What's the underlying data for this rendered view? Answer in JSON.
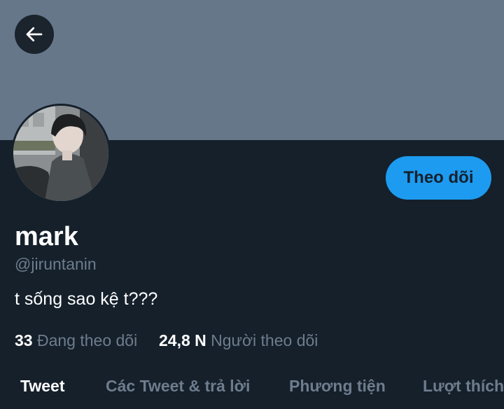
{
  "colors": {
    "background": "#15202b",
    "banner": "#66778a",
    "accent": "#1d9bf0",
    "muted_text": "#6e7d8d",
    "primary_text": "#ffffff"
  },
  "header": {
    "back_icon": "arrow-left-icon"
  },
  "profile": {
    "avatar_icon": "profile-photo",
    "follow_label": "Theo dõi",
    "display_name": "mark",
    "handle": "@jiruntanin",
    "bio": "t sống sao kệ t???"
  },
  "stats": {
    "following_count": "33",
    "following_label": "Đang theo dõi",
    "followers_count": "24,8 N",
    "followers_label": "Người theo dõi"
  },
  "tabs": [
    {
      "label": "Tweet",
      "active": true
    },
    {
      "label": "Các Tweet & trả lời",
      "active": false
    },
    {
      "label": "Phương tiện",
      "active": false
    },
    {
      "label": "Lượt thích",
      "active": false
    }
  ]
}
